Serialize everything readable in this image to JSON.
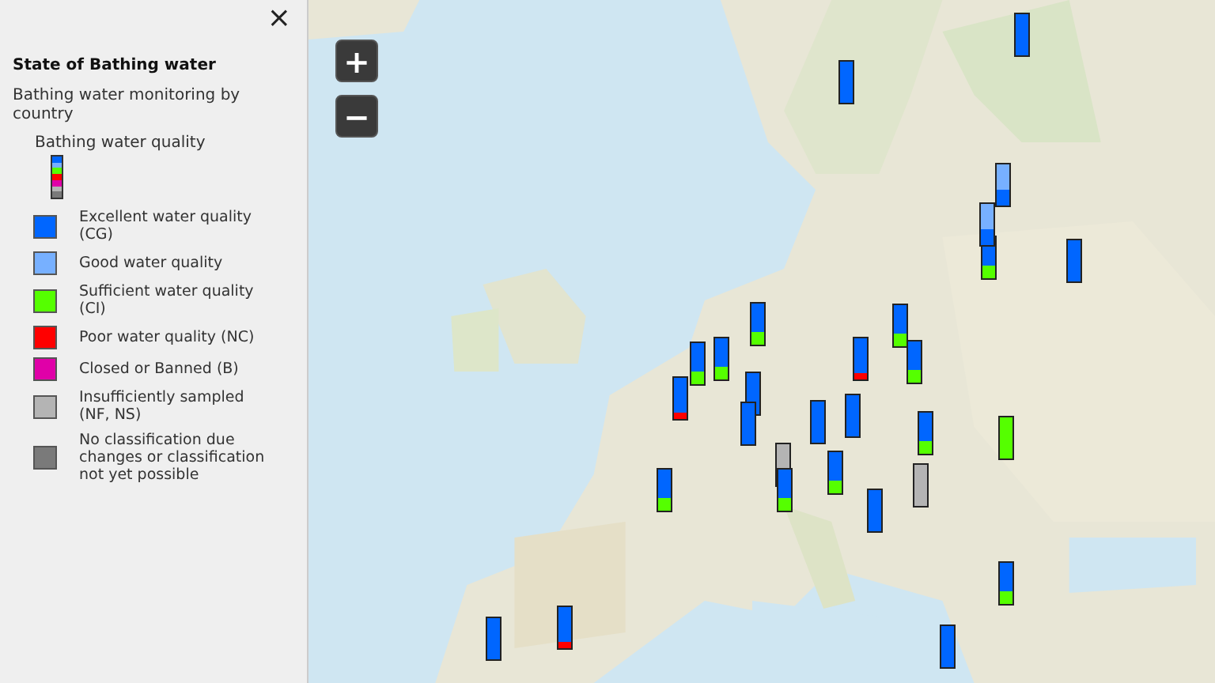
{
  "panel": {
    "close": "×",
    "title": "State of Bathing water",
    "subtitle": "Bathing water monitoring by country",
    "legend_title": "Bathing water quality",
    "legend": [
      {
        "label": "Excellent water quality (CG)",
        "color": "#0066ff"
      },
      {
        "label": "Good water quality",
        "color": "#77b0ff"
      },
      {
        "label": "Sufficient water quality (CI)",
        "color": "#55ff00"
      },
      {
        "label": "Poor water quality (NC)",
        "color": "#ff0000"
      },
      {
        "label": "Closed or Banned (B)",
        "color": "#e000a8"
      },
      {
        "label": "Insufficiently sampled (NF, NS)",
        "color": "#b4b4b4"
      },
      {
        "label": "No classification due changes or classification not yet possible",
        "color": "#7a7a7a"
      }
    ]
  },
  "map": {
    "kind": "picture",
    "zoom_in": "+",
    "zoom_out": "−"
  }
}
